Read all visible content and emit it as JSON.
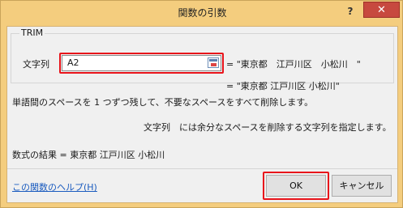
{
  "window": {
    "title": "関数の引数",
    "help_glyph": "?",
    "close_glyph": "✕"
  },
  "function": {
    "name": "TRIM",
    "arg_label": "文字列",
    "arg_input_value": "A2",
    "arg_value": "= \"東京都　江戸川区　小松川　\"",
    "result_inline": "= \"東京都 江戸川区 小松川\"",
    "description": "単語間のスペースを 1 つずつ残して、不要なスペースをすべて削除します。",
    "arg_description": "文字列　には余分なスペースを削除する文字列を指定します。"
  },
  "footer": {
    "formula_result": "数式の結果 =  東京都 江戸川区 小松川",
    "help_link": "この関数のヘルプ(H)",
    "ok_label": "OK",
    "cancel_label": "キャンセル"
  },
  "colors": {
    "title_bar": "#f4cd7e",
    "close_button": "#c7493f",
    "highlight": "#e8141b",
    "link": "#1a5bbf"
  }
}
